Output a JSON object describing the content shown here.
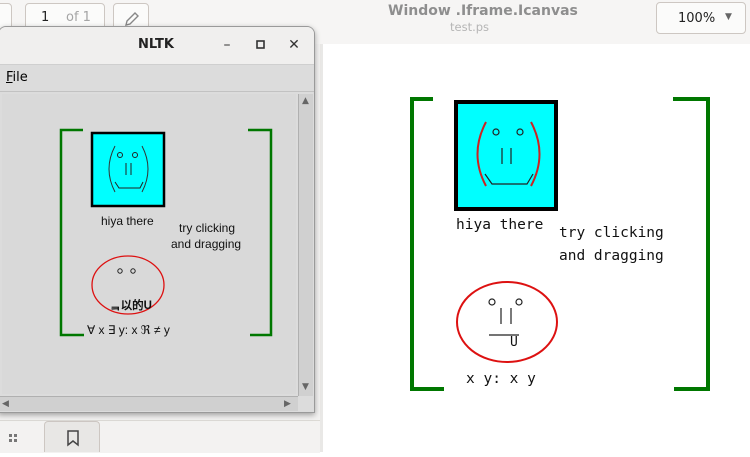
{
  "viewer": {
    "page_current": "1",
    "page_of": "of 1",
    "title": "Window .Iframe.Icanvas",
    "subtitle": "test.ps",
    "zoom": "100%",
    "zoom_caret": "▼"
  },
  "nltk": {
    "title": "NLTK",
    "min": "–",
    "max": "▫",
    "close": "✕",
    "menu_file_underlined": "F",
    "menu_file_rest": "ile"
  },
  "content": {
    "label_face": "hiya there",
    "label_try1": "try clicking",
    "label_try2": "and dragging",
    "face_glyph_u": "U",
    "small_jumble": "ᆿ以的U",
    "small_formula": "∀ x ∃ y: x ℜ ≠ y",
    "page_formula": "x y: x    y"
  },
  "colors": {
    "bracket": "#007700",
    "face_fill": "#00ffff",
    "face_border": "#000000",
    "oval": "#dd1111",
    "paren": "#cc2222"
  }
}
